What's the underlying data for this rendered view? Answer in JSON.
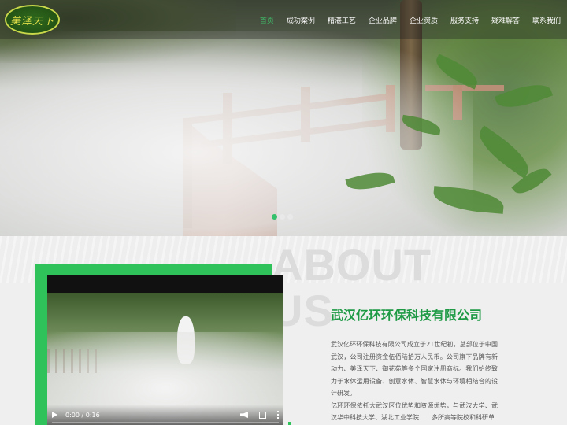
{
  "logo": {
    "text": "美泽天下"
  },
  "nav": {
    "items": [
      {
        "label": "首页",
        "active": true
      },
      {
        "label": "成功案例",
        "active": false
      },
      {
        "label": "精湛工艺",
        "active": false
      },
      {
        "label": "企业品牌",
        "active": false
      },
      {
        "label": "企业资质",
        "active": false
      },
      {
        "label": "服务支持",
        "active": false
      },
      {
        "label": "疑难解答",
        "active": false
      },
      {
        "label": "联系我们",
        "active": false
      }
    ]
  },
  "slider": {
    "count": 3,
    "active_index": 0
  },
  "about": {
    "ghost_line1": "ABOUT",
    "ghost_line2": "US",
    "company_name": "武汉亿环环保科技有限公司",
    "paragraph1": "武汉亿环环保科技有限公司成立于21世纪初，总部位于中国武汉，公司注册资金伍佰陆拾万人民币。公司旗下品牌有新动力、美泽天下、御花苑等多个国家注册商标。我们始终致力于水体运用设备、创意水体、智慧水体与环境相结合的设计研发。",
    "paragraph2": "亿环环保依托大武汉区位优势和资源优势，与武汉大学、武汉华中科技大学、湖北工业学院……多所高等院校和科研单"
  },
  "video": {
    "time": "0:00 / 0:16"
  },
  "colors": {
    "accent": "#2fc15a",
    "title": "#1e9a45",
    "nav_active": "#3fc06b"
  }
}
